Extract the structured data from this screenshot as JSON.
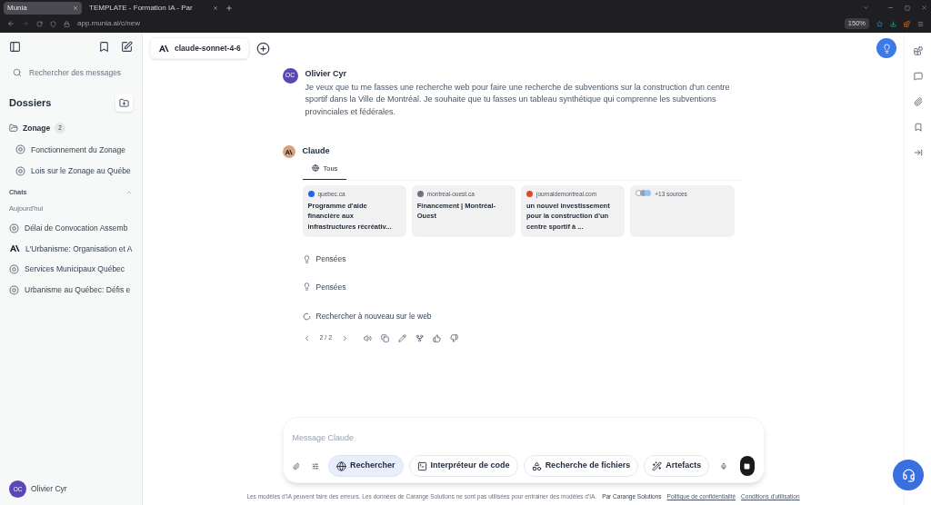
{
  "browser": {
    "tabs": [
      {
        "label": "Munia",
        "selected": true
      },
      {
        "label": "TEMPLATE - Formation IA - Par",
        "selected": false
      }
    ],
    "url": "app.munia.ai/c/new",
    "zoom": "150%"
  },
  "sidebar": {
    "search_placeholder": "Rechercher des messages",
    "folders_title": "Dossiers",
    "folders": [
      {
        "name": "Zonage",
        "count": "2",
        "expanded": true,
        "children": [
          {
            "title": "Fonctionnement du Zonage"
          },
          {
            "title": "Lois sur le Zonage au Québe"
          }
        ]
      }
    ],
    "chats_title": "Chats",
    "chats_expanded": true,
    "chats_group": "Aujourd'hui",
    "chats": [
      {
        "title": "Délai de Convocation Assemb",
        "kind": "openai"
      },
      {
        "title": "L'Urbanisme: Organisation et A",
        "kind": "anthropic"
      },
      {
        "title": "Services Municipaux Québec",
        "kind": "openai"
      },
      {
        "title": "Urbanisme au Québec: Défis e",
        "kind": "openai"
      }
    ],
    "user": {
      "initials": "OC",
      "name": "Olivier Cyr"
    }
  },
  "header": {
    "model": "claude-sonnet-4-6"
  },
  "messages": [
    {
      "kind": "user",
      "initials": "OC",
      "author": "Olivier Cyr",
      "text": "Je veux que tu me fasses une recherche web pour faire une recherche de subventions sur la construction d'un centre sportif dans la Ville de Montréal. Je souhaite que tu fasses un tableau synthétique qui comprenne les subventions provinciales et fédérales."
    },
    {
      "kind": "assistant",
      "author": "Claude",
      "tabs": [
        {
          "label": "Tous",
          "selected": true
        }
      ],
      "sources": [
        {
          "domain": "quebec.ca",
          "title": "Programme d'aide financière aux infrastructures récréativ...",
          "color": "#2563eb"
        },
        {
          "domain": "montreal-ouest.ca",
          "title": "Financement | Montréal-Ouest",
          "color": "#6b7280"
        },
        {
          "domain": "journaldemontreal.com",
          "title": "un nouvel investissement pour la construction d'un centre sportif à ...",
          "color": "#e0482b"
        }
      ],
      "more_sources": "+13 sources",
      "steps": [
        {
          "kind": "thought",
          "label": "Pensées"
        },
        {
          "kind": "thought",
          "label": "Pensées"
        },
        {
          "kind": "search",
          "label": "Rechercher à nouveau sur le web"
        }
      ],
      "pager": "2 / 2"
    }
  ],
  "composer": {
    "placeholder": "Message Claude",
    "tools": [
      {
        "label": "Rechercher",
        "selected": true,
        "kind": "globe"
      },
      {
        "label": "Interpréteur de code",
        "selected": false,
        "kind": "terminal"
      },
      {
        "label": "Recherche de fichiers",
        "selected": false,
        "kind": "files"
      },
      {
        "label": "Artefacts",
        "selected": false,
        "kind": "wand"
      }
    ]
  },
  "footer": {
    "disclaimer": "Les modèles d'IA peuvent faire des erreurs. Les données de Carange Solutions ne sont pas utilisées pour entrainer des modèles d'IA.",
    "by": "Par Carange Solutions",
    "links": [
      "Politique de confidentialité",
      "Conditions d'utilisation"
    ]
  }
}
